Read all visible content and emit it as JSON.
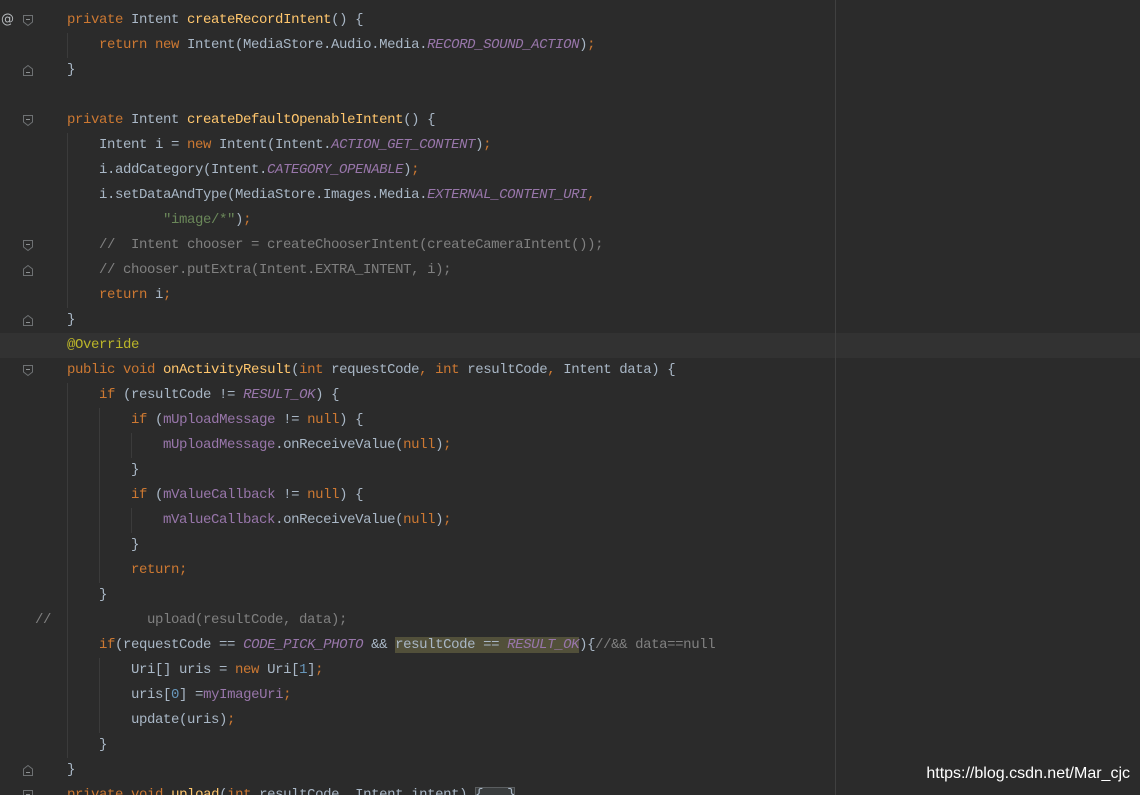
{
  "editor": {
    "gutter_marker": "@",
    "background": "#2B2B2B",
    "default_color": "#A9B7C6",
    "caret_row_color": "#323232",
    "lines": [
      {
        "fold": "fold-start-icon",
        "tokens": [
          {
            "text": "    "
          },
          {
            "text": "private",
            "color": "#CC7832"
          },
          {
            "text": " Intent "
          },
          {
            "text": "createRecordIntent",
            "color": "#FFC66D"
          },
          {
            "text": "() {"
          }
        ]
      },
      {
        "tokens": [
          {
            "text": "        "
          },
          {
            "text": "return new",
            "color": "#CC7832"
          },
          {
            "text": " Intent(MediaStore.Audio.Media."
          },
          {
            "text": "RECORD_SOUND_ACTION",
            "color": "#9876AA",
            "italic": true
          },
          {
            "text": ")"
          },
          {
            "text": ";",
            "color": "#CC7832"
          }
        ]
      },
      {
        "fold": "fold-end-icon",
        "tokens": [
          {
            "text": "    }"
          }
        ]
      },
      {
        "tokens": []
      },
      {
        "fold": "fold-start-icon",
        "tokens": [
          {
            "text": "    "
          },
          {
            "text": "private",
            "color": "#CC7832"
          },
          {
            "text": " Intent "
          },
          {
            "text": "createDefaultOpenableIntent",
            "color": "#FFC66D"
          },
          {
            "text": "() {"
          }
        ]
      },
      {
        "tokens": [
          {
            "text": "        Intent i = "
          },
          {
            "text": "new",
            "color": "#CC7832"
          },
          {
            "text": " Intent(Intent."
          },
          {
            "text": "ACTION_GET_CONTENT",
            "color": "#9876AA",
            "italic": true
          },
          {
            "text": ")"
          },
          {
            "text": ";",
            "color": "#CC7832"
          }
        ]
      },
      {
        "tokens": [
          {
            "text": "        i.addCategory(Intent."
          },
          {
            "text": "CATEGORY_OPENABLE",
            "color": "#9876AA",
            "italic": true
          },
          {
            "text": ")"
          },
          {
            "text": ";",
            "color": "#CC7832"
          }
        ]
      },
      {
        "tokens": [
          {
            "text": "        i.setDataAndType(MediaStore.Images.Media."
          },
          {
            "text": "EXTERNAL_CONTENT_URI",
            "color": "#9876AA",
            "italic": true
          },
          {
            "text": ",",
            "color": "#CC7832"
          }
        ]
      },
      {
        "tokens": [
          {
            "text": "                "
          },
          {
            "text": "\"image/*\"",
            "color": "#6A8759"
          },
          {
            "text": ")"
          },
          {
            "text": ";",
            "color": "#CC7832"
          }
        ]
      },
      {
        "fold": "fold-start-icon",
        "tokens": [
          {
            "text": "        "
          },
          {
            "text": "//  Intent chooser = createChooserIntent(createCameraIntent());",
            "color": "#808080"
          }
        ]
      },
      {
        "fold": "fold-end-icon",
        "tokens": [
          {
            "text": "        "
          },
          {
            "text": "// chooser.putExtra(Intent.EXTRA_INTENT, i);",
            "color": "#808080"
          }
        ]
      },
      {
        "tokens": [
          {
            "text": "        "
          },
          {
            "text": "return",
            "color": "#CC7832"
          },
          {
            "text": " i"
          },
          {
            "text": ";",
            "color": "#CC7832"
          }
        ]
      },
      {
        "fold": "fold-end-icon",
        "tokens": [
          {
            "text": "    }"
          }
        ]
      },
      {
        "current": true,
        "tokens": [
          {
            "text": "    "
          },
          {
            "text": "@Override",
            "color": "#BBB529"
          }
        ]
      },
      {
        "fold": "fold-start-icon",
        "tokens": [
          {
            "text": "    "
          },
          {
            "text": "public void",
            "color": "#CC7832"
          },
          {
            "text": " "
          },
          {
            "text": "onActivityResult",
            "color": "#FFC66D"
          },
          {
            "text": "("
          },
          {
            "text": "int",
            "color": "#CC7832"
          },
          {
            "text": " requestCode"
          },
          {
            "text": ",",
            "color": "#CC7832"
          },
          {
            "text": " "
          },
          {
            "text": "int",
            "color": "#CC7832"
          },
          {
            "text": " resultCode"
          },
          {
            "text": ",",
            "color": "#CC7832"
          },
          {
            "text": " Intent data) {"
          }
        ]
      },
      {
        "tokens": [
          {
            "text": "        "
          },
          {
            "text": "if",
            "color": "#CC7832"
          },
          {
            "text": " (resultCode != "
          },
          {
            "text": "RESULT_OK",
            "color": "#9876AA",
            "italic": true
          },
          {
            "text": ") {"
          }
        ]
      },
      {
        "tokens": [
          {
            "text": "            "
          },
          {
            "text": "if",
            "color": "#CC7832"
          },
          {
            "text": " ("
          },
          {
            "text": "mUploadMessage",
            "color": "#9876AA"
          },
          {
            "text": " != "
          },
          {
            "text": "null",
            "color": "#CC7832"
          },
          {
            "text": ") {"
          }
        ]
      },
      {
        "tokens": [
          {
            "text": "                "
          },
          {
            "text": "mUploadMessage",
            "color": "#9876AA"
          },
          {
            "text": ".onReceiveValue("
          },
          {
            "text": "null",
            "color": "#CC7832"
          },
          {
            "text": ")"
          },
          {
            "text": ";",
            "color": "#CC7832"
          }
        ]
      },
      {
        "tokens": [
          {
            "text": "            }"
          }
        ]
      },
      {
        "tokens": [
          {
            "text": "            "
          },
          {
            "text": "if",
            "color": "#CC7832"
          },
          {
            "text": " ("
          },
          {
            "text": "mValueCallback",
            "color": "#9876AA"
          },
          {
            "text": " != "
          },
          {
            "text": "null",
            "color": "#CC7832"
          },
          {
            "text": ") {"
          }
        ]
      },
      {
        "tokens": [
          {
            "text": "                "
          },
          {
            "text": "mValueCallback",
            "color": "#9876AA"
          },
          {
            "text": ".onReceiveValue("
          },
          {
            "text": "null",
            "color": "#CC7832"
          },
          {
            "text": ")"
          },
          {
            "text": ";",
            "color": "#CC7832"
          }
        ]
      },
      {
        "tokens": [
          {
            "text": "            }"
          }
        ]
      },
      {
        "tokens": [
          {
            "text": "            "
          },
          {
            "text": "return;",
            "color": "#CC7832"
          }
        ]
      },
      {
        "tokens": [
          {
            "text": "        }"
          }
        ]
      },
      {
        "tokens": [
          {
            "text": "//            upload(resultCode, data);",
            "color": "#808080"
          }
        ]
      },
      {
        "tokens": [
          {
            "text": "        "
          },
          {
            "text": "if",
            "color": "#CC7832"
          },
          {
            "text": "(requestCode == "
          },
          {
            "text": "CODE_PICK_PHOTO",
            "color": "#9876AA",
            "italic": true
          },
          {
            "text": " && "
          },
          {
            "text": "resultCode == ",
            "highlight": "#52503A"
          },
          {
            "text": "RESULT_OK",
            "color": "#9876AA",
            "italic": true,
            "highlight": "#52503A"
          },
          {
            "text": "){"
          },
          {
            "text": "//&& data==null",
            "color": "#808080"
          }
        ]
      },
      {
        "tokens": [
          {
            "text": "            Uri[] uris = "
          },
          {
            "text": "new",
            "color": "#CC7832"
          },
          {
            "text": " Uri["
          },
          {
            "text": "1",
            "color": "#6897BB"
          },
          {
            "text": "]"
          },
          {
            "text": ";",
            "color": "#CC7832"
          }
        ]
      },
      {
        "tokens": [
          {
            "text": "            uris["
          },
          {
            "text": "0",
            "color": "#6897BB"
          },
          {
            "text": "] ="
          },
          {
            "text": "myImageUri",
            "color": "#9876AA"
          },
          {
            "text": ";",
            "color": "#CC7832"
          }
        ]
      },
      {
        "tokens": [
          {
            "text": "            update(uris)"
          },
          {
            "text": ";",
            "color": "#CC7832"
          }
        ]
      },
      {
        "tokens": [
          {
            "text": "        }"
          }
        ]
      },
      {
        "fold": "fold-end-icon",
        "tokens": [
          {
            "text": "    }"
          }
        ]
      },
      {
        "fold": "fold-start-icon",
        "tokens": [
          {
            "text": "    "
          },
          {
            "text": "private void",
            "color": "#CC7832"
          },
          {
            "text": " "
          },
          {
            "text": "upload",
            "color": "#FFC66D"
          },
          {
            "text": "("
          },
          {
            "text": "int",
            "color": "#CC7832"
          },
          {
            "text": " resultCode"
          },
          {
            "text": ",",
            "color": "#CC7832"
          },
          {
            "text": " Intent intent) "
          },
          {
            "text": "{...}",
            "folded": true
          }
        ]
      }
    ]
  },
  "watermark": "https://blog.csdn.net/Mar_cjc"
}
